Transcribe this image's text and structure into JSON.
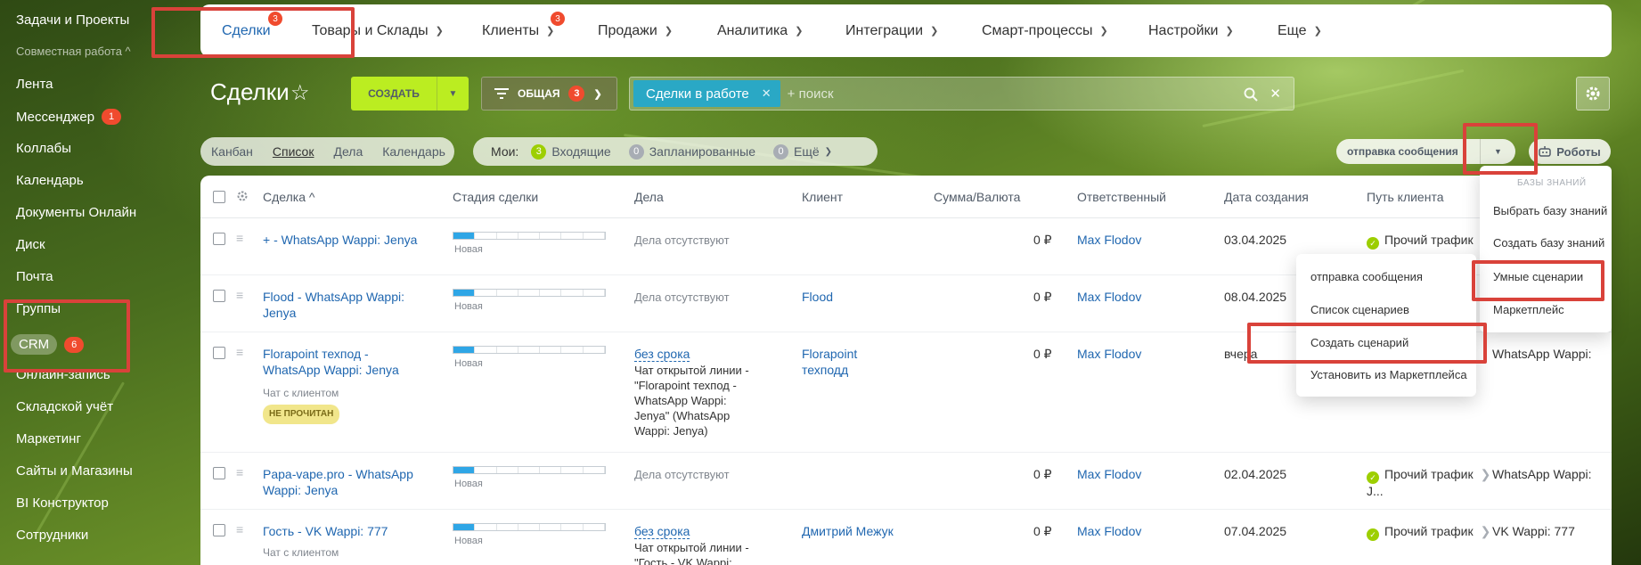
{
  "sidebar": {
    "items": [
      {
        "label": "Задачи и Проекты"
      },
      {
        "label": "Совместная работа ^"
      },
      {
        "label": "Лента"
      },
      {
        "label": "Мессенджер",
        "badge": "1"
      },
      {
        "label": "Коллабы"
      },
      {
        "label": "Календарь"
      },
      {
        "label": "Документы Онлайн"
      },
      {
        "label": "Диск"
      },
      {
        "label": "Почта"
      },
      {
        "label": "Группы"
      },
      {
        "label": "CRM",
        "badge": "6"
      },
      {
        "label": "Онлайн-запись"
      },
      {
        "label": "Складской учёт"
      },
      {
        "label": "Маркетинг"
      },
      {
        "label": "Сайты и Магазины"
      },
      {
        "label": "BI Конструктор"
      },
      {
        "label": "Сотрудники"
      }
    ]
  },
  "topnav": {
    "items": [
      {
        "label": "Сделки",
        "badge": "3"
      },
      {
        "label": "Товары и Склады"
      },
      {
        "label": "Клиенты",
        "badge": "3"
      },
      {
        "label": "Продажи"
      },
      {
        "label": "Аналитика"
      },
      {
        "label": "Интеграции"
      },
      {
        "label": "Смарт-процессы"
      },
      {
        "label": "Настройки"
      },
      {
        "label": "Еще"
      }
    ]
  },
  "toolbar": {
    "title": "Сделки",
    "create_label": "СОЗДАТЬ",
    "filter_label": "ОБЩАЯ",
    "filter_badge": "3",
    "chip_label": "Сделки в работе",
    "search_placeholder": "+ поиск"
  },
  "views": [
    "Канбан",
    "Список",
    "Дела",
    "Календарь"
  ],
  "counters": {
    "label": "Мои:",
    "items": [
      {
        "count": "3",
        "label": "Входящие"
      },
      {
        "count": "0",
        "label": "Запланированные"
      },
      {
        "count": "0",
        "label": "Ещё"
      }
    ]
  },
  "pipeline_select": "отправка сообщения",
  "robots_label": "Роботы",
  "table": {
    "columns": [
      "Сделка ^",
      "Стадия сделки",
      "Дела",
      "Клиент",
      "Сумма/Валюта",
      "Ответственный",
      "Дата создания",
      "Путь клиента"
    ],
    "rows": [
      {
        "deal": "+ - WhatsApp Wappi: Jenya",
        "stage": "Новая",
        "activity": "Дела отсутствуют",
        "client": "",
        "sum": "0 ₽",
        "resp": "Max Flodov",
        "date": "03.04.2025",
        "path": "Прочий трафик"
      },
      {
        "deal": "Flood - WhatsApp Wappi: Jenya",
        "stage": "Новая",
        "activity": "Дела отсутствуют",
        "client": "Flood",
        "sum": "0 ₽",
        "resp": "Max Flodov",
        "date": "08.04.2025",
        "path": ""
      },
      {
        "deal": "Florapoint техпод - WhatsApp Wappi: Jenya",
        "sub": "Чат с клиентом",
        "tag": "НЕ ПРОЧИТАН",
        "stage": "Новая",
        "activity_link": "без срока",
        "activity": "Чат открытой линии - \"Florapoint техпод - WhatsApp Wappi: Jenya\" (WhatsApp Wappi: Jenya)",
        "client": "Florapoint техподд",
        "sum": "0 ₽",
        "resp": "Max Flodov",
        "date": "вчера",
        "path_end": "WhatsApp Wappi:"
      },
      {
        "deal": "Papa-vape.pro - WhatsApp Wappi: Jenya",
        "stage": "Новая",
        "activity": "Дела отсутствуют",
        "client": "",
        "sum": "0 ₽",
        "resp": "Max Flodov",
        "date": "02.04.2025",
        "path": "Прочий трафик",
        "path_sub": "J...",
        "path_end": "WhatsApp Wappi:"
      },
      {
        "deal": "Гость - VK Wappi: 777",
        "sub": "Чат с клиентом",
        "stage": "Новая",
        "activity_link": "без срока",
        "activity": "Чат открытой линии - \"Гость - VK Wappi:",
        "client": "Дмитрий Межук",
        "sum": "0 ₽",
        "resp": "Max Flodov",
        "date": "07.04.2025",
        "path": "Прочий трафик",
        "path_end": "VK Wappi: 777"
      }
    ]
  },
  "kb_menu": {
    "header": "БАЗЫ ЗНАНИЙ",
    "items": [
      "Выбрать базу знаний",
      "Создать базу знаний",
      "Умные сценарии",
      "Маркетплейс"
    ]
  },
  "scenario_menu": {
    "items": [
      "отправка сообщения",
      "Список сценариев",
      "Создать сценарий",
      "Установить из Маркетплейса"
    ]
  },
  "colors": {
    "accent": "#2fc6f6",
    "create": "#bbed21",
    "annotation": "#d9423a",
    "link": "#2067b0"
  }
}
